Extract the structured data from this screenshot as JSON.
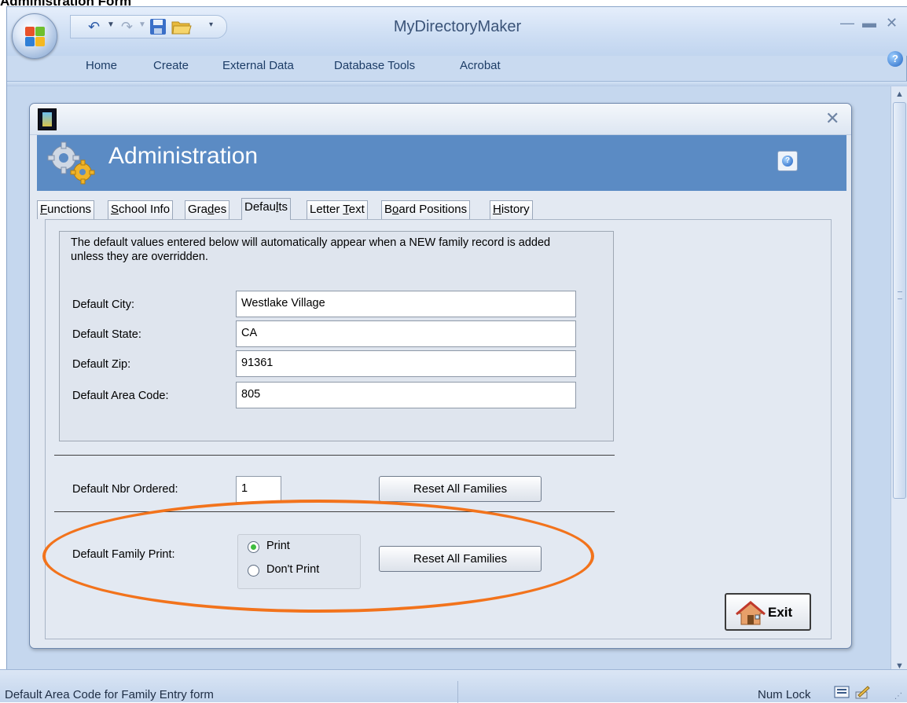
{
  "caption": "Administration Form",
  "app": {
    "title": "MyDirectoryMaker",
    "ribbon_tabs": [
      "Home",
      "Create",
      "External Data",
      "Database Tools",
      "Acrobat"
    ]
  },
  "form": {
    "title": "Administration",
    "tabs": [
      {
        "pre": "",
        "key": "F",
        "post": "unctions"
      },
      {
        "pre": "",
        "key": "S",
        "post": "chool Info"
      },
      {
        "pre": "Gra",
        "key": "d",
        "post": "es"
      },
      {
        "pre": "Defau",
        "key": "l",
        "post": "ts"
      },
      {
        "pre": "Letter ",
        "key": "T",
        "post": "ext"
      },
      {
        "pre": "B",
        "key": "o",
        "post": "ard Positions"
      },
      {
        "pre": "",
        "key": "H",
        "post": "istory"
      }
    ],
    "active_tab": "Defaults",
    "info_text": "The default values entered below will automatically appear when a NEW family record is added unless they are overridden.",
    "fields": [
      {
        "label": "Default City:",
        "value": "Westlake Village"
      },
      {
        "label": "Default State:",
        "value": "CA"
      },
      {
        "label": "Default Zip:",
        "value": "91361"
      },
      {
        "label": "Default Area Code:",
        "value": "805"
      }
    ],
    "nbr_ordered": {
      "label": "Default Nbr Ordered:",
      "value": "1"
    },
    "reset_label": "Reset All Families",
    "family_print": {
      "label": "Default Family Print:",
      "options": [
        "Print",
        "Don't Print"
      ],
      "selected": "Print"
    },
    "exit_label": "Exit"
  },
  "status": {
    "text": "Default Area Code for Family Entry form",
    "num_lock": "Num Lock"
  },
  "colors": {
    "header_blue": "#5b8bc4",
    "highlight_orange": "#f2731c",
    "radio_selected": "#3fbd3f"
  }
}
